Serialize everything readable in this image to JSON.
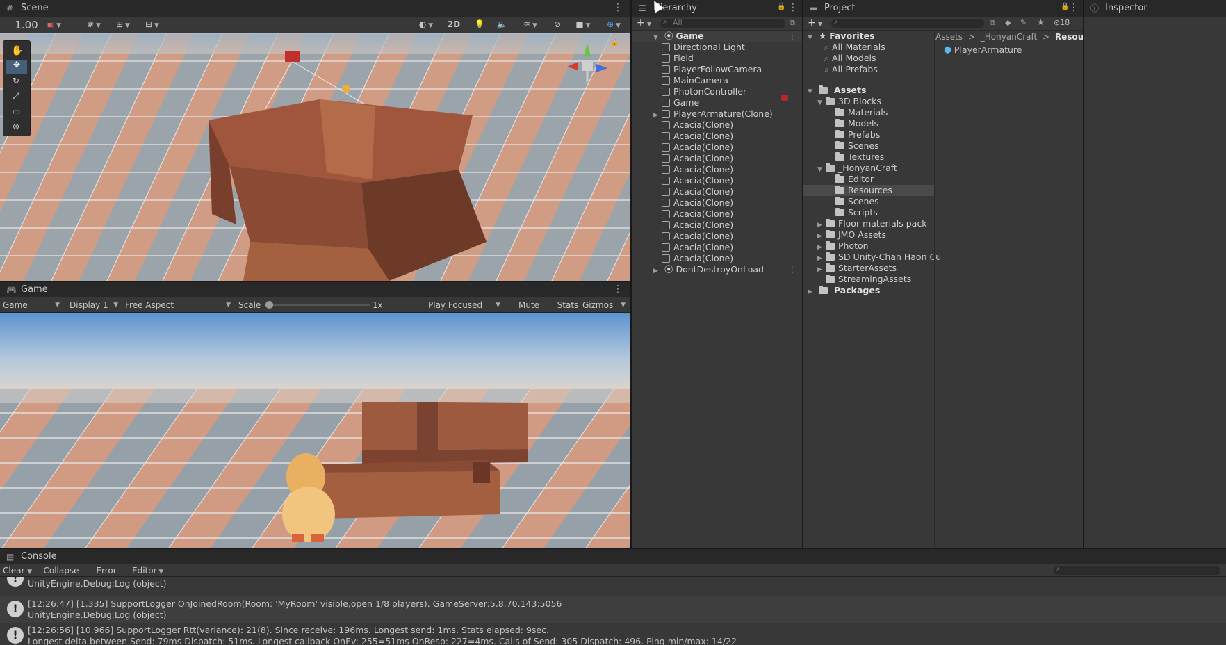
{
  "scene": {
    "tab_label": "Scene",
    "scale_readout": "1",
    "mode_2d": "2D"
  },
  "game": {
    "tab_label": "Game",
    "view_dropdown": "Game",
    "display_dropdown": "Display 1",
    "aspect_dropdown": "Free Aspect",
    "scale_label": "Scale",
    "scale_value": "1x",
    "play_focused": "Play Focused",
    "mute_audio": "Mute Audio",
    "stats": "Stats",
    "gizmos": "Gizmos"
  },
  "hierarchy": {
    "tab_label": "Hierarchy",
    "search_placeholder": "All",
    "root": "Game",
    "items": [
      "Directional Light",
      "Field",
      "PlayerFollowCamera",
      "MainCamera",
      "PhotonController",
      "Game",
      "PlayerArmature(Clone)",
      "Acacia(Clone)",
      "Acacia(Clone)",
      "Acacia(Clone)",
      "Acacia(Clone)",
      "Acacia(Clone)",
      "Acacia(Clone)",
      "Acacia(Clone)",
      "Acacia(Clone)",
      "Acacia(Clone)",
      "Acacia(Clone)",
      "Acacia(Clone)",
      "Acacia(Clone)",
      "Acacia(Clone)"
    ],
    "dontdestroy": "DontDestroyOnLoad"
  },
  "project": {
    "tab_label": "Project",
    "hidden_count": "18",
    "favorites_label": "Favorites",
    "favorites": [
      "All Materials",
      "All Models",
      "All Prefabs"
    ],
    "assets_label": "Assets",
    "tree": [
      {
        "label": "3D Blocks",
        "indent": 1,
        "arrow": "▼",
        "open": true
      },
      {
        "label": "Materials",
        "indent": 2,
        "arrow": "",
        "open": false
      },
      {
        "label": "Models",
        "indent": 2,
        "arrow": "",
        "open": false
      },
      {
        "label": "Prefabs",
        "indent": 2,
        "arrow": "",
        "open": false
      },
      {
        "label": "Scenes",
        "indent": 2,
        "arrow": "",
        "open": false
      },
      {
        "label": "Textures",
        "indent": 2,
        "arrow": "",
        "open": false
      },
      {
        "label": "_HonyanCraft",
        "indent": 1,
        "arrow": "▼",
        "open": true
      },
      {
        "label": "Editor",
        "indent": 2,
        "arrow": "",
        "open": false
      },
      {
        "label": "Resources",
        "indent": 2,
        "arrow": "",
        "open": false,
        "selected": true
      },
      {
        "label": "Scenes",
        "indent": 2,
        "arrow": "",
        "open": false
      },
      {
        "label": "Scripts",
        "indent": 2,
        "arrow": "",
        "open": false
      },
      {
        "label": "Floor materials pack",
        "indent": 1,
        "arrow": "▶",
        "open": false
      },
      {
        "label": "JMO Assets",
        "indent": 1,
        "arrow": "▶",
        "open": false
      },
      {
        "label": "Photon",
        "indent": 1,
        "arrow": "▶",
        "open": false
      },
      {
        "label": "SD Unity-Chan Haon Cu",
        "indent": 1,
        "arrow": "▶",
        "open": false
      },
      {
        "label": "StarterAssets",
        "indent": 1,
        "arrow": "▶",
        "open": false
      },
      {
        "label": "StreamingAssets",
        "indent": 1,
        "arrow": "",
        "open": false
      }
    ],
    "packages_label": "Packages",
    "breadcrumb": [
      "Assets",
      "_HonyanCraft",
      "Resources"
    ],
    "breadcrumb_sep": ">",
    "asset_item": "PlayerArmature"
  },
  "inspector": {
    "tab_label": "Inspector"
  },
  "console": {
    "tab_label": "Console",
    "clear": "Clear",
    "collapse": "Collapse",
    "error_pause": "Error Pause",
    "editor": "Editor",
    "logs": [
      {
        "line1": "",
        "line2": "UnityEngine.Debug:Log (object)"
      },
      {
        "line1": "[12:26:47] [1.335] SupportLogger OnJoinedRoom(Room: 'MyRoom' visible,open 1/8 players).  GameServer:5.8.70.143:5056",
        "line2": "UnityEngine.Debug:Log (object)"
      },
      {
        "line1": "[12:26:56] [10.966] SupportLogger Rtt(variance): 21(8). Since receive: 196ms. Longest send: 1ms. Stats elapsed: 9sec.",
        "line2": "Longest delta between Send: 79ms Dispatch: 51ms. Longest callback OnEv: 255=51ms OnResp: 227=4ms. Calls of Send: 305 Dispatch: 496. Ping min/max: 14/22"
      }
    ]
  },
  "colors": {
    "editor_bg": "#191919",
    "panel_bg": "#383838",
    "selection": "#4a4a4a",
    "brick": "#9c5a40",
    "floor_light": "#d6a48c",
    "floor_dark": "#8f9ba3",
    "sky": "#6fa3d6"
  }
}
